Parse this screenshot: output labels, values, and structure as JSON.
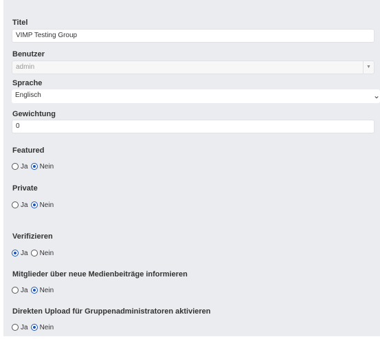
{
  "form": {
    "title": {
      "label": "Titel",
      "value": "VIMP Testing Group"
    },
    "user": {
      "label": "Benutzer",
      "value": "admin"
    },
    "language": {
      "label": "Sprache",
      "value": "Englisch"
    },
    "weight": {
      "label": "Gewichtung",
      "value": "0"
    },
    "featured": {
      "label": "Featured",
      "options": [
        "Ja",
        "Nein"
      ],
      "selected": "Nein"
    },
    "private": {
      "label": "Private",
      "options": [
        "Ja",
        "Nein"
      ],
      "selected": "Nein"
    },
    "verify": {
      "label": "Verifizieren",
      "options": [
        "Ja",
        "Nein"
      ],
      "selected": "Ja"
    },
    "notify": {
      "label": "Mitglieder über neue Medienbeiträge informieren",
      "options": [
        "Ja",
        "Nein"
      ],
      "selected": "Nein"
    },
    "direct_upload": {
      "label": "Direkten Upload für Gruppenadministratoren aktivieren",
      "options": [
        "Ja",
        "Nein"
      ],
      "selected": "Nein"
    }
  },
  "icons": {
    "select_caret": "▼",
    "open_caret": "⌄"
  },
  "colors": {
    "panel": "#eaecef",
    "radio_checked": "#1a56b8"
  }
}
